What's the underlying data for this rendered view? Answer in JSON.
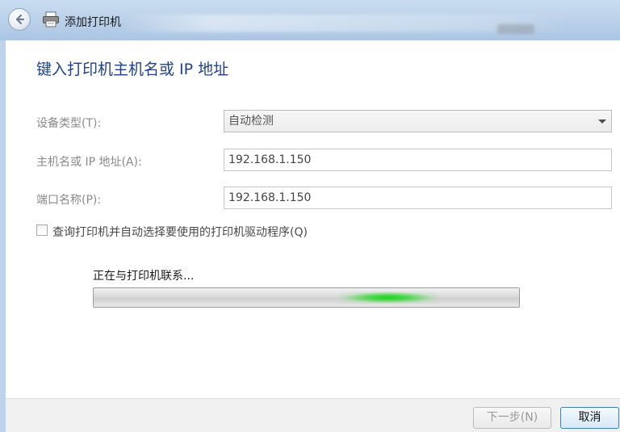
{
  "window": {
    "title": "添加打印机",
    "icons": {
      "back": "back-arrow-icon",
      "printer": "printer-icon"
    }
  },
  "page": {
    "heading": "键入打印机主机名或 IP 地址"
  },
  "form": {
    "device_type": {
      "label": "设备类型(T):",
      "value": "自动检测"
    },
    "hostname": {
      "label": "主机名或 IP 地址(A):",
      "value": "192.168.1.150"
    },
    "port_name": {
      "label": "端口名称(P):",
      "value": "192.168.1.150"
    },
    "query_printer": {
      "label": "查询打印机并自动选择要使用的打印机驱动程序(Q)",
      "checked": false
    }
  },
  "status": {
    "text": "正在与打印机联系...",
    "progress_style": "marquee"
  },
  "buttons": {
    "next": "下一步(N)",
    "cancel": "取消"
  },
  "colors": {
    "heading": "#1f3f8f",
    "progress_glow": "#19d31b",
    "cancel_border": "#3c7fb1"
  }
}
